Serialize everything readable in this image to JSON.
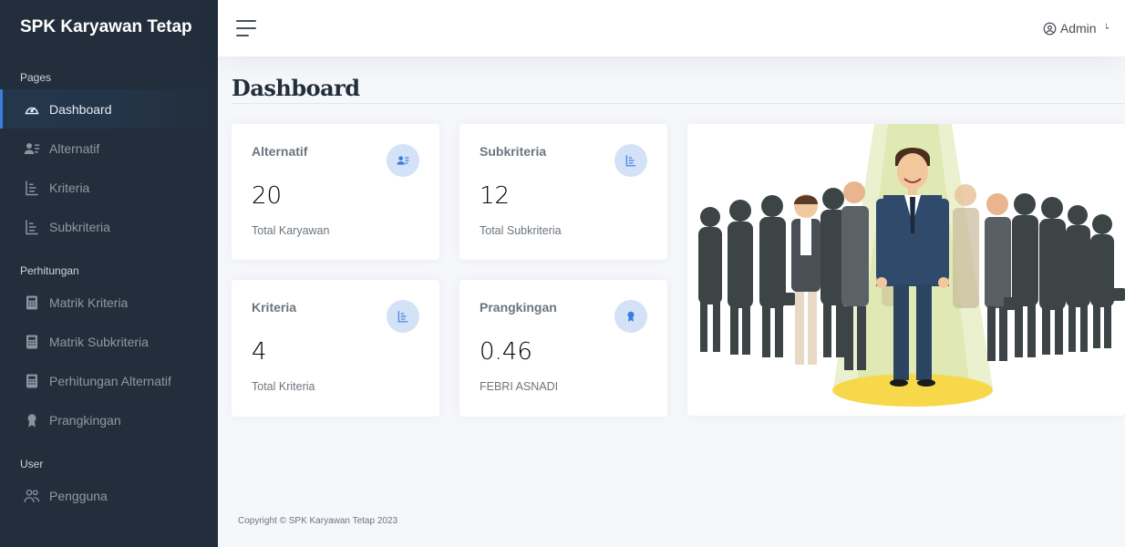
{
  "brand": "SPK Karyawan Tetap",
  "sidebar": {
    "sections": [
      {
        "header": "Pages"
      },
      {
        "header": "Perhitungan"
      },
      {
        "header": "User"
      }
    ],
    "items": [
      {
        "label": "Dashboard",
        "icon": "dashboard-icon",
        "active": true
      },
      {
        "label": "Alternatif",
        "icon": "user-list-icon"
      },
      {
        "label": "Kriteria",
        "icon": "hierarchy-icon"
      },
      {
        "label": "Subkriteria",
        "icon": "hierarchy-icon"
      },
      {
        "label": "Matrik Kriteria",
        "icon": "calculator-icon"
      },
      {
        "label": "Matrik Subkriteria",
        "icon": "calculator-icon"
      },
      {
        "label": "Perhitungan Alternatif",
        "icon": "calculator-icon"
      },
      {
        "label": "Prangkingan",
        "icon": "award-icon"
      },
      {
        "label": "Pengguna",
        "icon": "users-icon"
      }
    ]
  },
  "topbar": {
    "user_label": "Admin"
  },
  "main": {
    "title": "Dashboard",
    "cards": [
      {
        "label": "Alternatif",
        "value": "20",
        "sub": "Total Karyawan",
        "icon": "user-list-icon"
      },
      {
        "label": "Subkriteria",
        "value": "12",
        "sub": "Total Subkriteria",
        "icon": "hierarchy-icon"
      },
      {
        "label": "Kriteria",
        "value": "4",
        "sub": "Total Kriteria",
        "icon": "hierarchy-icon"
      },
      {
        "label": "Prangkingan",
        "value": "0.46",
        "sub": "FEBRI ASNADI",
        "icon": "award-icon"
      }
    ]
  },
  "footer": "Copyright © SPK Karyawan Tetap 2023",
  "colors": {
    "sidebar_bg": "#222e3c",
    "accent": "#3b7ddd",
    "badge_bg": "#d3e2f7"
  }
}
